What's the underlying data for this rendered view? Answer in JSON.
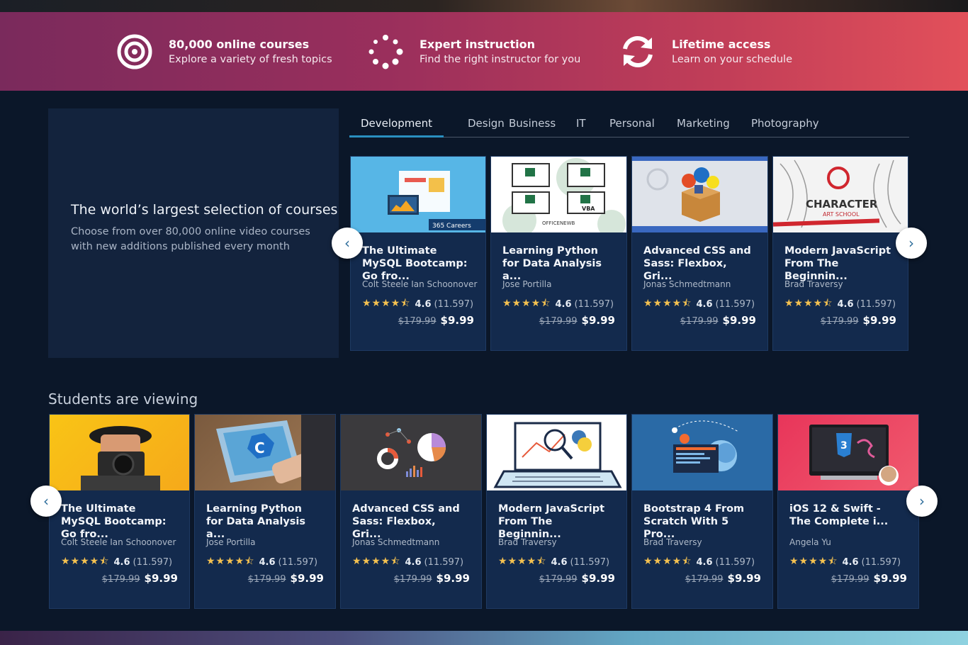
{
  "features": [
    {
      "icon": "target-icon",
      "title": "80,000 online courses",
      "subtitle": "Explore a variety of fresh topics"
    },
    {
      "icon": "spinner-icon",
      "title": "Expert instruction",
      "subtitle": "Find the right instructor for you"
    },
    {
      "icon": "refresh-icon",
      "title": "Lifetime access",
      "subtitle": "Learn on your schedule"
    }
  ],
  "hero": {
    "title": "The world’s largest selection of courses",
    "subtitle": "Choose from over 80,000 online video courses with new additions published every month"
  },
  "tabs": [
    "Development",
    "Design",
    "Business",
    "IT",
    "Personal",
    "Marketing",
    "Photography"
  ],
  "active_tab": "Development",
  "featured_courses": [
    {
      "title": "The Ultimate MySQL Bootcamp: Go fro...",
      "author": "Colt Steele Ian Schoonover",
      "rating": "4.6",
      "reviews": "(11.597)",
      "old_price": "$179.99",
      "price": "$9.99",
      "badge": "365 Careers",
      "stars": 4.5
    },
    {
      "title": "Learning Python for Data Analysis a...",
      "author": "Jose Portilla",
      "rating": "4.6",
      "reviews": "(11.597)",
      "old_price": "$179.99",
      "price": "$9.99",
      "thumb_text": "OFFICENEWB",
      "thumb_label": "VBA",
      "stars": 4.5
    },
    {
      "title": "Advanced CSS and Sass: Flexbox, Gri...",
      "author": "Jonas Schmedtmann",
      "rating": "4.6",
      "reviews": "(11.597)",
      "old_price": "$179.99",
      "price": "$9.99",
      "stars": 4.5
    },
    {
      "title": "Modern JavaScript From The Beginnin...",
      "author": "Brad Traversy",
      "rating": "4.6",
      "reviews": "(11.597)",
      "old_price": "$179.99",
      "price": "$9.99",
      "thumb_text": "CHARACTER",
      "thumb_sub": "ART SCHOOL",
      "stars": 4.5
    }
  ],
  "students_title": "Students are viewing",
  "viewing_courses": [
    {
      "title": "The Ultimate MySQL Bootcamp: Go fro...",
      "author": "Colt Steele Ian Schoonover",
      "rating": "4.6",
      "reviews": "(11.597)",
      "old_price": "$179.99",
      "price": "$9.99",
      "stars": 4.5
    },
    {
      "title": "Learning Python for Data Analysis a...",
      "author": "Jose Portilla",
      "rating": "4.6",
      "reviews": "(11.597)",
      "old_price": "$179.99",
      "price": "$9.99",
      "stars": 4.5
    },
    {
      "title": "Advanced CSS and Sass: Flexbox, Gri...",
      "author": "Jonas Schmedtmann",
      "rating": "4.6",
      "reviews": "(11.597)",
      "old_price": "$179.99",
      "price": "$9.99",
      "stars": 4.5
    },
    {
      "title": "Modern JavaScript From The Beginnin...",
      "author": "Brad Traversy",
      "rating": "4.6",
      "reviews": "(11.597)",
      "old_price": "$179.99",
      "price": "$9.99",
      "stars": 4.5
    },
    {
      "title": "Bootstrap 4 From Scratch With 5 Pro...",
      "author": "Brad Traversy",
      "rating": "4.6",
      "reviews": "(11.597)",
      "old_price": "$179.99",
      "price": "$9.99",
      "stars": 4.5
    },
    {
      "title": "iOS 12 & Swift - The Complete i...",
      "author": "Angela Yu",
      "rating": "4.6",
      "reviews": "(11.597)",
      "old_price": "$179.99",
      "price": "$9.99",
      "stars": 4.5
    }
  ],
  "arrows": {
    "prev": "‹",
    "next": "›"
  },
  "colors": {
    "accent": "#2a8fbf",
    "star": "#f4c150",
    "card_bg": "#132a4d",
    "page_bg": "#0b1729"
  }
}
